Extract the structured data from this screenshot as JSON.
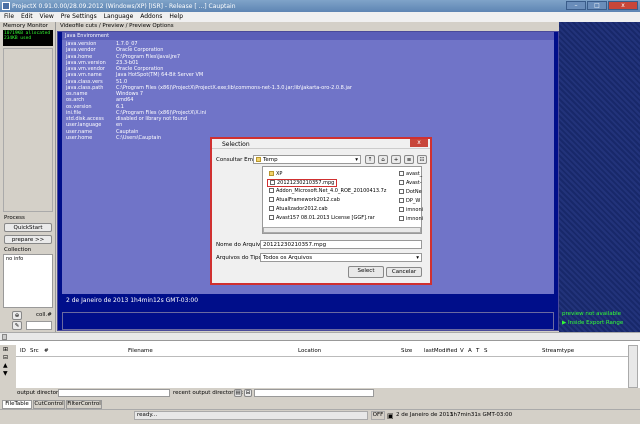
{
  "window": {
    "title": "ProjectX 0.91.0.00/28.09.2012 (Windows/XP) [ISR] - Release [ ...] Cauptain",
    "min": "–",
    "max": "□",
    "close": "x"
  },
  "menu": [
    "File",
    "Edit",
    "View",
    "Pre Settings",
    "Language",
    "Addons",
    "Help"
  ],
  "left": {
    "memory_label": "Memory Monitor",
    "memory_lines": [
      "10719KB allocated",
      "234KB used"
    ],
    "process_label": "Process",
    "quickstart": "QuickStart",
    "prepare": "prepare >>",
    "collection_label": "Collection",
    "collection_text": "no info",
    "coll_label": "coll.#"
  },
  "tabs_top": "Videofile cuts / Preview / Preview Options",
  "java": {
    "header": "Java Environment",
    "rows": [
      [
        "java.version",
        "1.7.0_07"
      ],
      [
        "java.vendor",
        "Oracle Corporation"
      ],
      [
        "java.home",
        "C:\\Program Files\\Java\\jre7"
      ],
      [
        "java.vm.version",
        "23.3-b01"
      ],
      [
        "java.vm.vendor",
        "Oracle Corporation"
      ],
      [
        "java.vm.name",
        "Java HotSpot(TM) 64-Bit Server VM"
      ],
      [
        "java.class.vers",
        "51.0"
      ],
      [
        "java.class.path",
        "C:\\Program Files (x86)\\ProjectX\\ProjectX.exe;lib\\commons-net-1.3.0.jar;lib\\jakarta-oro-2.0.8.jar"
      ],
      [
        "os.name",
        "Windows 7"
      ],
      [
        "os.arch",
        "amd64"
      ],
      [
        "os.version",
        "6.1"
      ],
      [
        "ini.file",
        "C:\\Program Files (x86)\\ProjectX\\X.ini"
      ],
      [
        "std.disk.access",
        "disabled or library not found"
      ],
      [
        "user.language",
        "en"
      ],
      [
        "user.name",
        "Cauptain"
      ],
      [
        "user.home",
        "C:\\Users\\Cauptain"
      ]
    ],
    "date": "2 de Janeiro de 2013    1h4min12s GMT-03:00"
  },
  "right": {
    "preview_na": "preview not available",
    "inside_export": "Inside Export Range"
  },
  "dialog": {
    "title": "Selection",
    "look_in_label": "Consultar Em:",
    "look_in_value": "Temp",
    "files_col1": [
      "XP",
      "20121230210357.mpg",
      "Addon_Microsoft.Net_4.0_ROE_20100413.7z",
      "AtualFramework2012.cab",
      "Atualizador2012.cab",
      "Avast157 08.01.2013 License [GGF].rar"
    ],
    "files_col2": [
      "avast_",
      "Avast-",
      "DotNe",
      "DP_W",
      "imnoni",
      "imnoni"
    ],
    "filename_label": "Nome do Arquivo:",
    "filename_value": "20121230210357.mpg",
    "filetype_label": "Arquivos do Tipo:",
    "filetype_value": "Todos os Arquivos",
    "select": "Select",
    "cancel": "Cancelar"
  },
  "table": {
    "columns": [
      "ID",
      "Src",
      "#",
      "Filename",
      "Location",
      "Size",
      "lastModified",
      "V",
      "A",
      "T",
      "S",
      "Streamtype"
    ]
  },
  "output": {
    "dir_label": "output directory:",
    "recent_label": "recent output directories:"
  },
  "bottom_tabs": [
    "FileTable",
    "CutControl",
    "FilterControl"
  ],
  "status": {
    "ready": "ready...",
    "off": "OFF",
    "date": "2 de Janeiro de 2013",
    "time": "1h7min31s GMT-03:00"
  }
}
